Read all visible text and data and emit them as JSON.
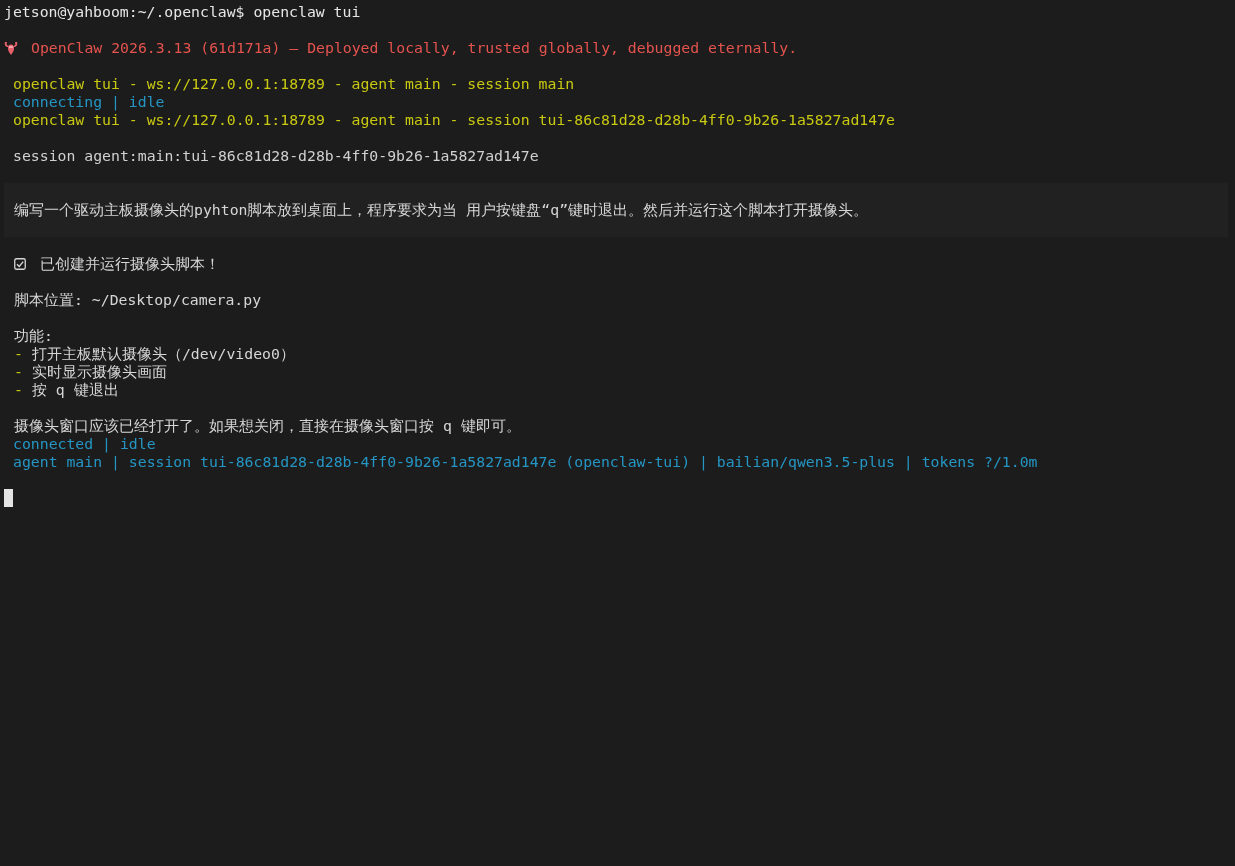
{
  "terminal": {
    "blocks": [
      {
        "kind": "plain",
        "lines": [
          {
            "kind": "prompt",
            "text": "jetson@yahboom:~/.openclaw$ openclaw tui"
          }
        ]
      },
      {
        "kind": "plain",
        "lines": [
          {
            "kind": "banner",
            "text": "OpenClaw 2026.3.13 (61d171a) — Deployed locally, trusted globally, debugged eternally."
          }
        ]
      },
      {
        "kind": "plain",
        "lines": [
          {
            "kind": "header",
            "text": "openclaw tui - ws://127.0.0.1:18789 - agent main - session main"
          },
          {
            "kind": "status",
            "text": "connecting | idle"
          },
          {
            "kind": "header",
            "text": "openclaw tui - ws://127.0.0.1:18789 - agent main - session tui-86c81d28-d28b-4ff0-9b26-1a5827ad147e"
          }
        ]
      },
      {
        "kind": "plain",
        "lines": [
          {
            "kind": "session",
            "text": "session agent:main:tui-86c81d28-d28b-4ff0-9b26-1a5827ad147e"
          }
        ]
      },
      {
        "kind": "user",
        "lines": [
          {
            "kind": "user",
            "text": "编写一个驱动主板摄像头的pyhton脚本放到桌面上，程序要求为当 用户按键盘“q”键时退出。然后并运行这个脚本打开摄像头。"
          }
        ]
      },
      {
        "kind": "plain",
        "lines": [
          {
            "kind": "check",
            "text": "已创建并运行摄像头脚本！"
          }
        ]
      },
      {
        "kind": "plain",
        "lines": [
          {
            "kind": "text",
            "text": "脚本位置: ~/Desktop/camera.py"
          }
        ]
      },
      {
        "kind": "plain",
        "lines": [
          {
            "kind": "text",
            "text": "功能:"
          },
          {
            "kind": "bullet",
            "marker": "-",
            "text": "打开主板默认摄像头（/dev/video0）"
          },
          {
            "kind": "bullet",
            "marker": "-",
            "text": "实时显示摄像头画面"
          },
          {
            "kind": "bullet",
            "marker": "-",
            "text": "按 q 键退出"
          }
        ]
      },
      {
        "kind": "plain",
        "lines": [
          {
            "kind": "text",
            "text": "摄像头窗口应该已经打开了。如果想关闭，直接在摄像头窗口按 q 键即可。"
          },
          {
            "kind": "status",
            "text": "connected | idle"
          },
          {
            "kind": "footer",
            "text": "agent main | session tui-86c81d28-d28b-4ff0-9b26-1a5827ad147e (openclaw-tui) | bailian/qwen3.5-plus | tokens ?/1.0m"
          }
        ]
      }
    ],
    "cursor": true
  }
}
